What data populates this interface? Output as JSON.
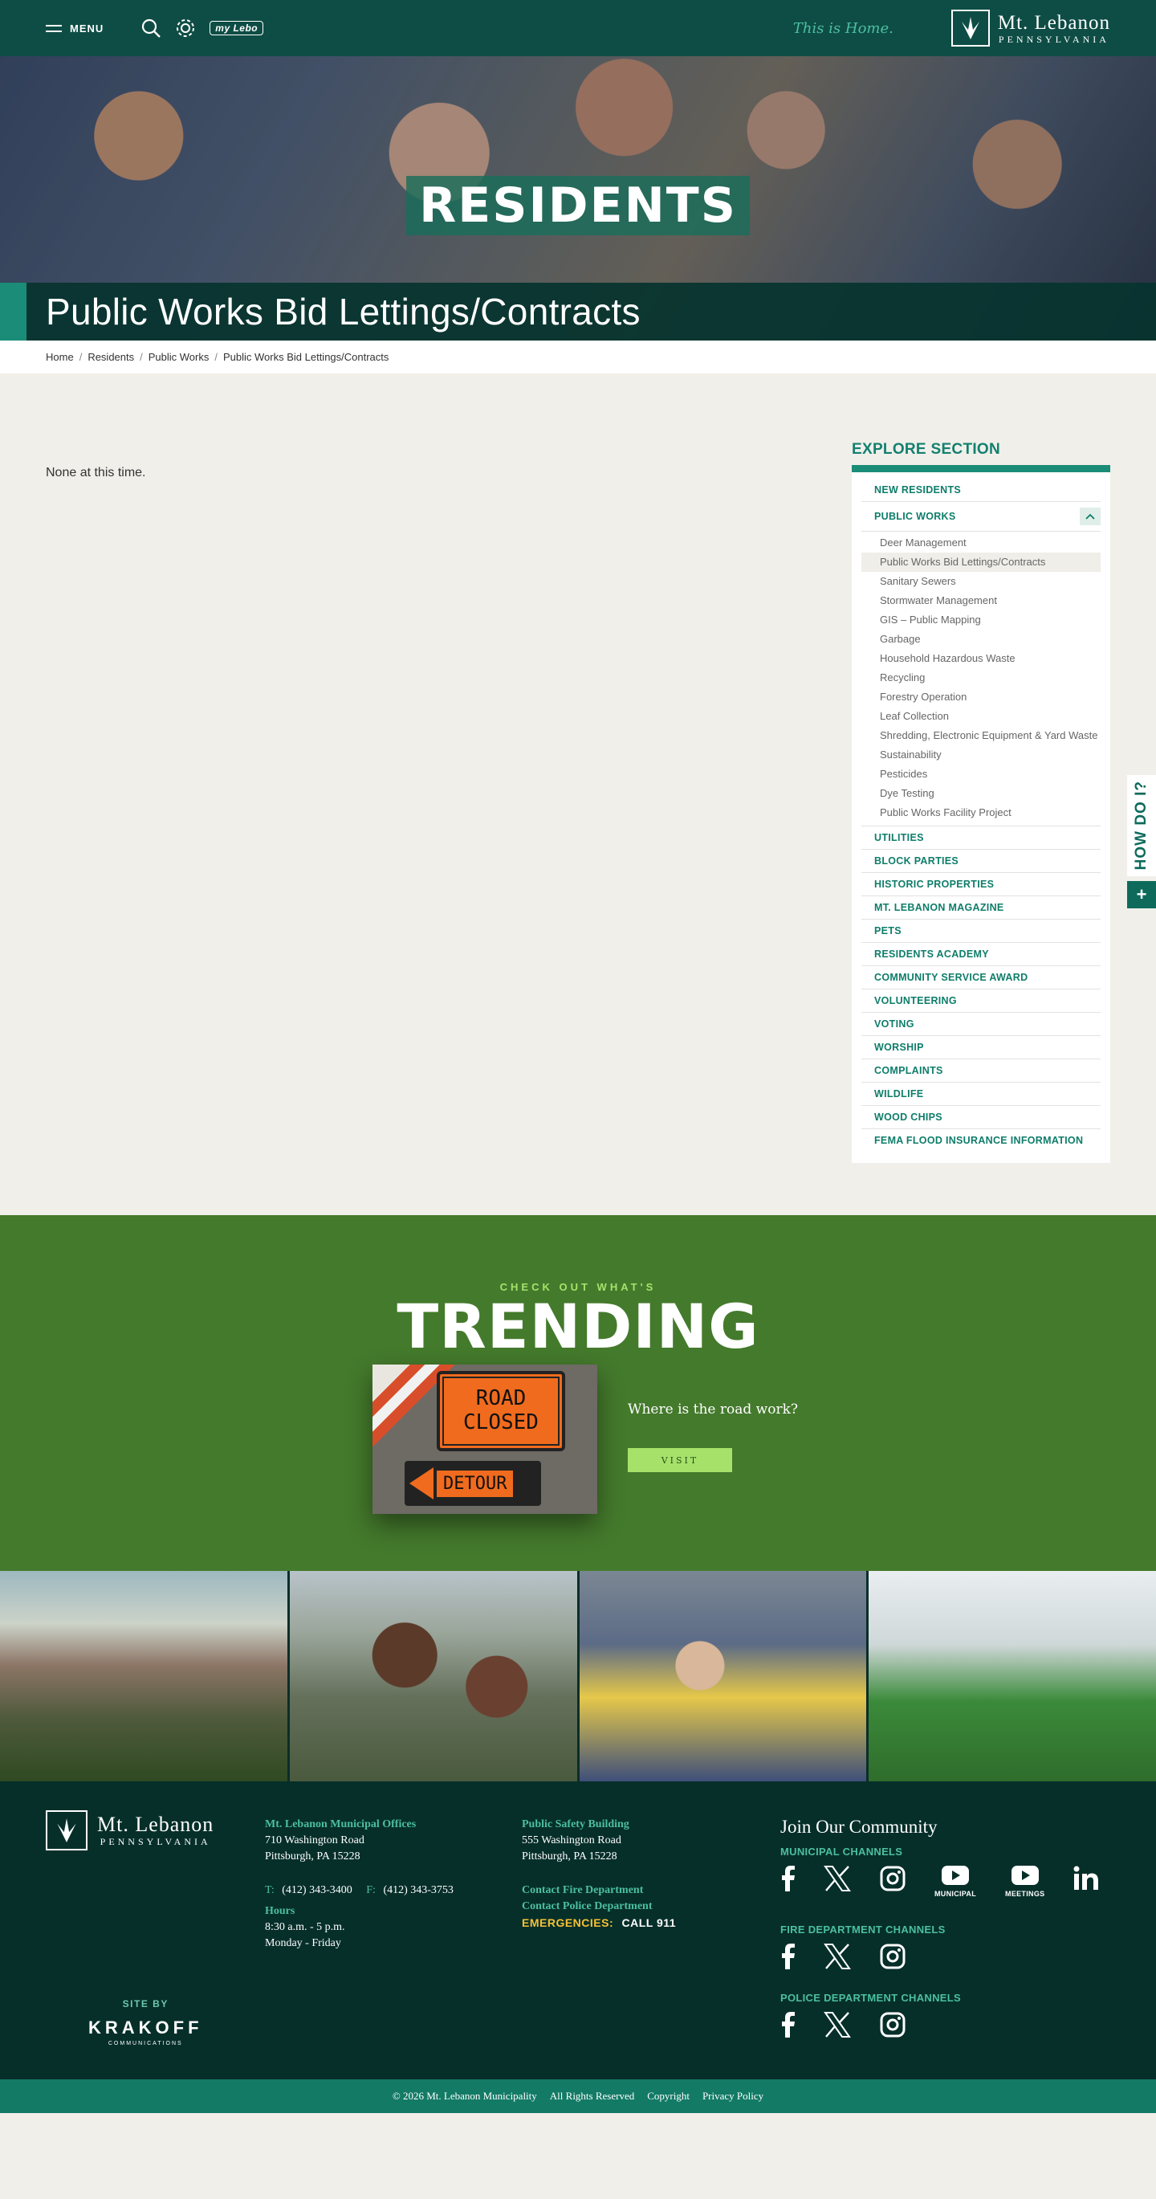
{
  "header": {
    "menu_label": "MENU",
    "mylebo_label": "my Lebo",
    "tagline": "This is Home.",
    "logo_main": "Mt. Lebanon",
    "logo_sub": "PENNSYLVANIA"
  },
  "hero": {
    "title": "RESIDENTS",
    "page_title": "Public Works Bid Lettings/Contracts"
  },
  "breadcrumb": [
    "Home",
    "Residents",
    "Public Works",
    "Public Works Bid Lettings/Contracts"
  ],
  "content": {
    "body_text": "None at this time."
  },
  "sidebar": {
    "title": "EXPLORE SECTION",
    "top_items": [
      "NEW RESIDENTS"
    ],
    "open_item": "PUBLIC WORKS",
    "sub_items": [
      "Deer Management",
      "Public Works Bid Lettings/Contracts",
      "Sanitary Sewers",
      "Stormwater Management",
      "GIS – Public Mapping",
      "Garbage",
      "Household Hazardous Waste",
      "Recycling",
      "Forestry Operation",
      "Leaf Collection",
      "Shredding, Electronic Equipment & Yard Waste",
      "Sustainability",
      "Pesticides",
      "Dye Testing",
      "Public Works Facility Project"
    ],
    "items": [
      "UTILITIES",
      "BLOCK PARTIES",
      "HISTORIC PROPERTIES",
      "MT. LEBANON MAGAZINE",
      "PETS",
      "RESIDENTS ACADEMY",
      "COMMUNITY SERVICE AWARD",
      "VOLUNTEERING",
      "VOTING",
      "WORSHIP",
      "COMPLAINTS",
      "WILDLIFE",
      "WOOD CHIPS",
      "FEMA FLOOD INSURANCE INFORMATION"
    ]
  },
  "howdo": {
    "label": "HOW DO I?",
    "plus": "+"
  },
  "trending": {
    "pre": "CHECK OUT WHAT'S",
    "title": "TRENDING",
    "sign_line1": "ROAD",
    "sign_line2": "CLOSED",
    "sign_detour": "DETOUR",
    "question": "Where is the road work?",
    "button": "VISIT"
  },
  "footer": {
    "logo_main": "Mt. Lebanon",
    "logo_sub": "PENNSYLVANIA",
    "municipal": {
      "heading": "Mt. Lebanon Municipal Offices",
      "address1": "710 Washington Road",
      "address2": "Pittsburgh, PA 15228",
      "t_label": "T:",
      "phone": "(412) 343-3400",
      "f_label": "F:",
      "fax": "(412) 343-3753",
      "hours_label": "Hours",
      "hours": "8:30 a.m. - 5 p.m.",
      "days": "Monday - Friday"
    },
    "safety": {
      "heading": "Public Safety Building",
      "address1": "555 Washington Road",
      "address2": "Pittsburgh, PA 15228",
      "fire_link": "Contact Fire Department",
      "police_link": "Contact Police Department",
      "emergencies_label": "EMERGENCIES:",
      "emergencies_value": "CALL 911"
    },
    "join": {
      "title": "Join Our Community",
      "municipal_label": "MUNICIPAL CHANNELS",
      "youtube_municipal": "MUNICIPAL",
      "youtube_meetings": "MEETINGS",
      "fire_label": "FIRE DEPARTMENT CHANNELS",
      "police_label": "POLICE DEPARTMENT CHANNELS"
    },
    "siteby_label": "SITE BY",
    "siteby_name": "KRAKOFF",
    "siteby_sub": "COMMUNICATIONS",
    "copyright": "© 2026 Mt. Lebanon Municipality",
    "rights": "All Rights Reserved",
    "copyright_link": "Copyright",
    "privacy_link": "Privacy Policy"
  }
}
